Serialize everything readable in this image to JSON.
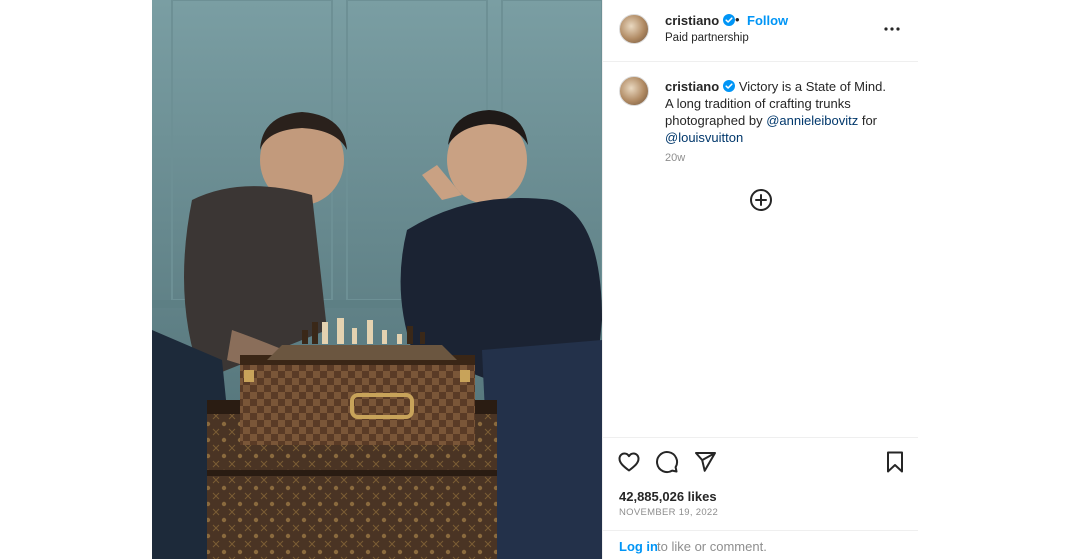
{
  "post": {
    "username": "cristiano",
    "verified": true,
    "separator": "•",
    "follow_label": "Follow",
    "subtitle": "Paid partnership",
    "more_icon": "more-horizontal-icon"
  },
  "caption": {
    "username": "cristiano",
    "text_1": "Victory is a State of Mind.",
    "text_2": "A long tradition of crafting trunks",
    "text_3": "photographed by",
    "mention_1": "@annieleibovitz",
    "text_4": "for",
    "mention_2": "@louisvuitton",
    "time": "20w",
    "load_more_icon": "add-circle-icon"
  },
  "actions": {
    "like_icon": "heart-icon",
    "comment_icon": "comment-icon",
    "share_icon": "send-icon",
    "save_icon": "bookmark-icon"
  },
  "stats": {
    "likes": "42,885,026 likes",
    "date": "NOVEMBER 19, 2022"
  },
  "footer": {
    "login_label": "Log in",
    "login_rest": "to like or comment."
  },
  "colors": {
    "accent": "#0095f6",
    "link": "#00376b",
    "muted": "#8e8e8e",
    "border": "#efefef"
  }
}
